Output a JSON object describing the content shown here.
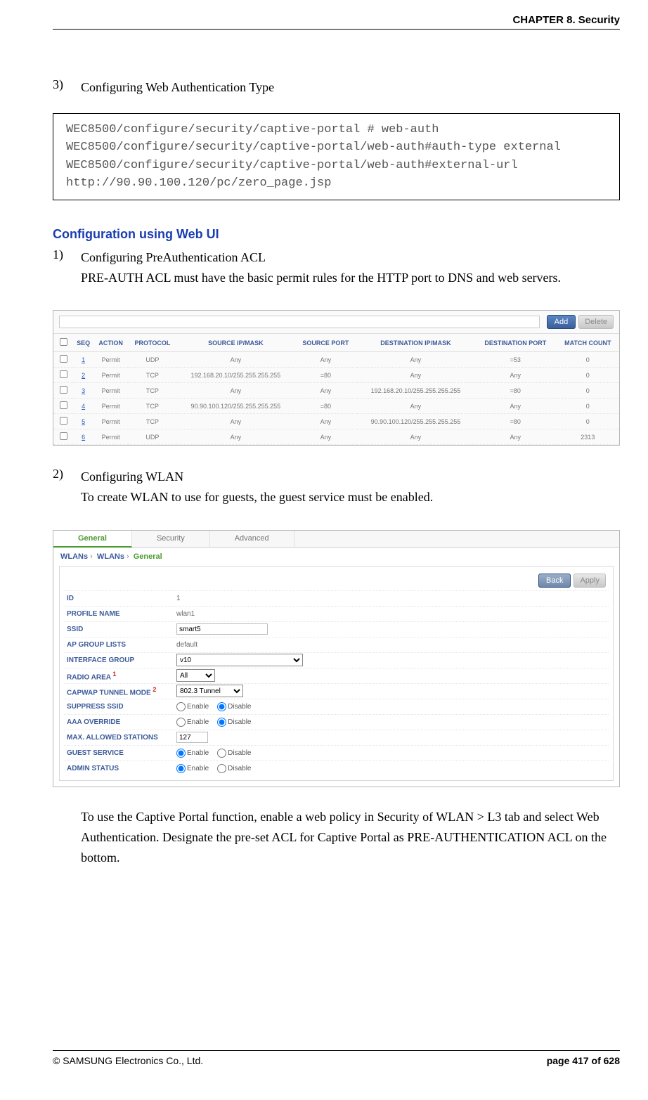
{
  "header": {
    "chapter": "CHAPTER 8. Security"
  },
  "step3": {
    "num": "3)",
    "title": "Configuring Web Authentication Type",
    "code": "WEC8500/configure/security/captive-portal # web-auth\nWEC8500/configure/security/captive-portal/web-auth#auth-type external\nWEC8500/configure/security/captive-portal/web-auth#external-url\nhttp://90.90.100.120/pc/zero_page.jsp"
  },
  "section2_heading": "Configuration using Web UI",
  "step1": {
    "num": "1)",
    "title": "Configuring PreAuthentication ACL",
    "desc": "PRE-AUTH ACL must have the basic permit rules for the HTTP port to DNS and web servers."
  },
  "acl": {
    "buttons": {
      "add": "Add",
      "delete": "Delete"
    },
    "headers": [
      "",
      "SEQ",
      "ACTION",
      "PROTOCOL",
      "SOURCE IP/MASK",
      "SOURCE PORT",
      "DESTINATION IP/MASK",
      "DESTINATION PORT",
      "MATCH COUNT"
    ],
    "rows": [
      {
        "seq": "1",
        "action": "Permit",
        "proto": "UDP",
        "sip": "Any",
        "sport": "Any",
        "dip": "Any",
        "dport": "=53",
        "count": "0"
      },
      {
        "seq": "2",
        "action": "Permit",
        "proto": "TCP",
        "sip": "192.168.20.10/255.255.255.255",
        "sport": "=80",
        "dip": "Any",
        "dport": "Any",
        "count": "0"
      },
      {
        "seq": "3",
        "action": "Permit",
        "proto": "TCP",
        "sip": "Any",
        "sport": "Any",
        "dip": "192.168.20.10/255.255.255.255",
        "dport": "=80",
        "count": "0"
      },
      {
        "seq": "4",
        "action": "Permit",
        "proto": "TCP",
        "sip": "90.90.100.120/255.255.255.255",
        "sport": "=80",
        "dip": "Any",
        "dport": "Any",
        "count": "0"
      },
      {
        "seq": "5",
        "action": "Permit",
        "proto": "TCP",
        "sip": "Any",
        "sport": "Any",
        "dip": "90.90.100.120/255.255.255.255",
        "dport": "=80",
        "count": "0"
      },
      {
        "seq": "6",
        "action": "Permit",
        "proto": "UDP",
        "sip": "Any",
        "sport": "Any",
        "dip": "Any",
        "dport": "Any",
        "count": "2313"
      }
    ]
  },
  "step2": {
    "num": "2)",
    "title": "Configuring WLAN",
    "desc": "To create WLAN to use for guests, the guest service must be enabled."
  },
  "wlan": {
    "tabs": {
      "general": "General",
      "security": "Security",
      "advanced": "Advanced"
    },
    "breadcrumb": {
      "a": "WLANs",
      "b": "WLANs",
      "c": "General"
    },
    "buttons": {
      "back": "Back",
      "apply": "Apply"
    },
    "fields": {
      "id_label": "ID",
      "id_value": "1",
      "profile_label": "PROFILE NAME",
      "profile_value": "wlan1",
      "ssid_label": "SSID",
      "ssid_value": "smart5",
      "apgroup_label": "AP GROUP LISTS",
      "apgroup_value": "default",
      "ifgroup_label": "INTERFACE GROUP",
      "ifgroup_value": "v10",
      "radio_label": "RADIO AREA",
      "radio_sup": "1",
      "radio_value": "All",
      "capwap_label": "CAPWAP TUNNEL MODE",
      "capwap_sup": "2",
      "capwap_value": "802.3 Tunnel",
      "suppress_label": "SUPPRESS SSID",
      "aaa_label": "AAA OVERRIDE",
      "max_label": "MAX. ALLOWED STATIONS",
      "max_value": "127",
      "guest_label": "GUEST SERVICE",
      "admin_label": "ADMIN STATUS",
      "enable": "Enable",
      "disable": "Disable"
    }
  },
  "post_wlan_para": "To use the Captive Portal function, enable a web policy in Security of WLAN > L3 tab and select Web Authentication. Designate the pre-set ACL for Captive Portal as PRE-AUTHENTICATION ACL on the bottom.",
  "footer": {
    "left": "© SAMSUNG Electronics Co., Ltd.",
    "right": "page 417 of 628"
  }
}
